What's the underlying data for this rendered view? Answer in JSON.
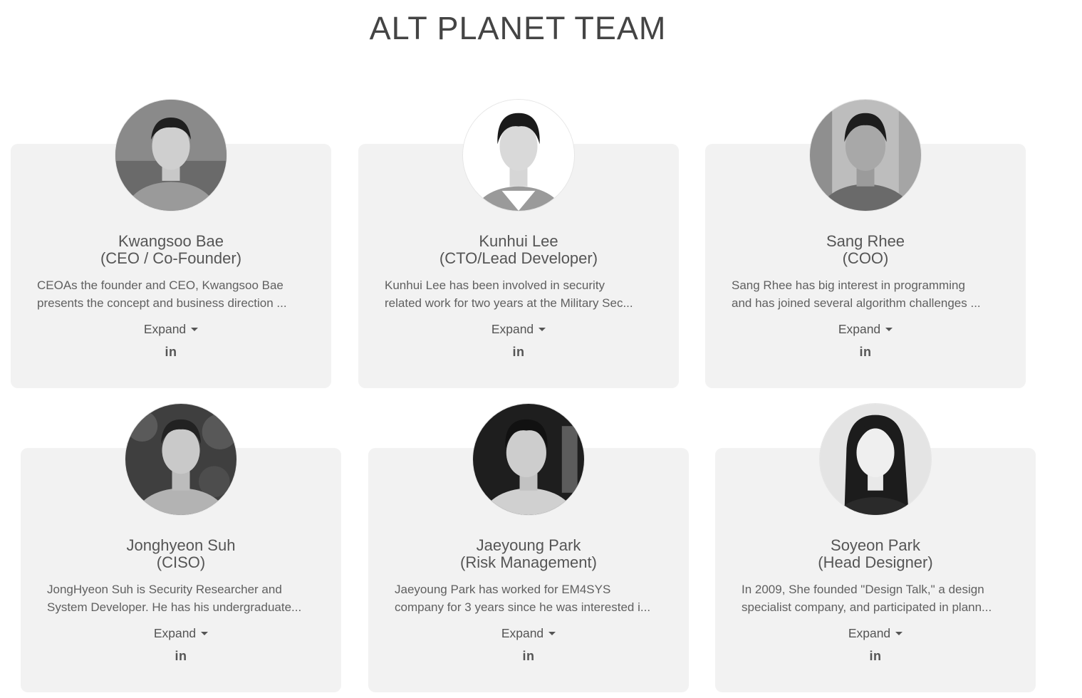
{
  "page": {
    "title": "ALT PLANET TEAM"
  },
  "members": [
    {
      "name": "Kwangsoo Bae",
      "role": "(CEO / Co-Founder)",
      "bio_line1": "CEOAs the founder and CEO, Kwangsoo Bae",
      "bio_line2": "presents the concept and business direction ...",
      "expand_label": "Expand",
      "social_icon": "linkedin-icon",
      "social_glyph": "in"
    },
    {
      "name": "Kunhui Lee",
      "role": "(CTO/Lead Developer)",
      "bio_line1": "Kunhui Lee has been involved in security",
      "bio_line2": "related work for two years at the Military Sec...",
      "expand_label": "Expand",
      "social_icon": "linkedin-icon",
      "social_glyph": "in"
    },
    {
      "name": "Sang Rhee",
      "role": "(COO)",
      "bio_line1": "Sang Rhee has big interest in programming",
      "bio_line2": "and has joined several algorithm challenges ...",
      "expand_label": "Expand",
      "social_icon": "linkedin-icon",
      "social_glyph": "in"
    },
    {
      "name": "Jonghyeon Suh",
      "role": "(CISO)",
      "bio_line1": "JongHyeon Suh is Security Researcher and",
      "bio_line2": "System Developer. He has his undergraduate...",
      "expand_label": "Expand",
      "social_icon": "linkedin-icon",
      "social_glyph": "in"
    },
    {
      "name": "Jaeyoung Park",
      "role": "(Risk Management)",
      "bio_line1": "Jaeyoung Park has worked for EM4SYS",
      "bio_line2": "company for 3 years since he was interested i...",
      "expand_label": "Expand",
      "social_icon": "linkedin-icon",
      "social_glyph": "in"
    },
    {
      "name": "Soyeon Park",
      "role": "(Head Designer)",
      "bio_line1": "In 2009, She founded \"Design Talk,\" a design",
      "bio_line2": "specialist company, and participated in plann...",
      "expand_label": "Expand",
      "social_icon": "linkedin-icon",
      "social_glyph": "in"
    }
  ],
  "colors": {
    "card_background": "#f2f2f2",
    "text": "#555555",
    "title": "#444444"
  }
}
